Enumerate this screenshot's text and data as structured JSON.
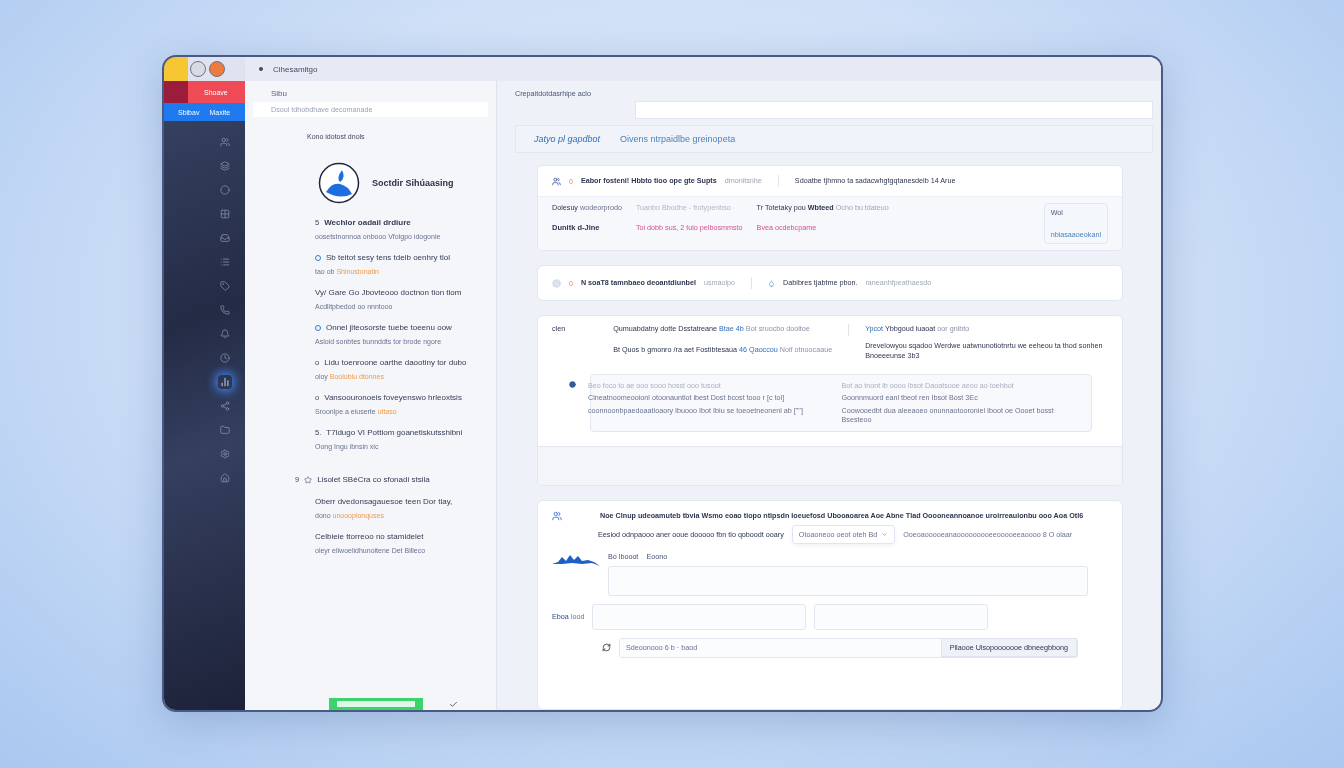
{
  "top_bar": {
    "title": "Cihesamitgo"
  },
  "sidebar": {
    "red_item": {
      "label": "Shoave"
    },
    "blue_item": {
      "labels": [
        "Sbibav",
        "Maxite"
      ]
    },
    "nav": [
      {
        "selected": false
      },
      {
        "selected": false
      },
      {
        "selected": false
      },
      {
        "selected": false
      },
      {
        "selected": false
      },
      {
        "selected": false
      },
      {
        "selected": false
      },
      {
        "selected": false
      },
      {
        "selected": false
      },
      {
        "selected": false
      },
      {
        "selected": true
      },
      {
        "selected": false
      },
      {
        "selected": false
      },
      {
        "selected": false
      },
      {
        "selected": false
      }
    ]
  },
  "panel": {
    "header": "Sibu",
    "search": {
      "placeholder": "Dsoul tdhobdhave decomanade"
    },
    "subtitle": "Kono idotost dnols",
    "profile": {
      "name": "Soctdir Sihúaasing"
    },
    "items": [
      {
        "kind": "numbered",
        "marker": "5",
        "title": "Wechlor oadail drdiure",
        "detail": "oosetstnonnoa onbooo Vfolgpo idogonie",
        "bold": true
      },
      {
        "kind": "dot",
        "title": "Sb teitot sesy tens tdeib oenhry tlol",
        "detail": "tao ob",
        "link": "Shinustonatin",
        "bold": false
      },
      {
        "kind": "plain",
        "title": "Vy/ Gare Go Jbovteooo doctnon tion tlom",
        "detail": "Acdlitpbedod oo nnntooo",
        "bold": false
      },
      {
        "kind": "dot",
        "title": "Onnel jiteosorste tuebe toeenu oow",
        "detail": "Asloid sonbtes bunnddts tor brode ngore",
        "bold": false
      },
      {
        "kind": "numbered",
        "marker": "o",
        "title": "Lidu toenroone oarthe daootiny tor dubo",
        "detail": "oloy",
        "link": "Booloblu dtonnes",
        "bold": false
      },
      {
        "kind": "numbered",
        "marker": "o",
        "title": "Vansoouronoeis foveyenswo hrleoxtsis",
        "detail": "Sroonlpe a eiuserte",
        "link": "uttaso",
        "bold": false
      },
      {
        "kind": "numbered",
        "marker": "5.",
        "title": "T7ldugo VI Pottiom goanetiskutsshibni",
        "detail": "Oong Ingu ibnsin xic",
        "bold": false
      },
      {
        "kind": "heading",
        "marker": "9",
        "title": "Lisolet SBéCra co sfonadi stsila",
        "bold": false
      },
      {
        "kind": "plain",
        "title": "Oberr dvedonsagauesoe teen Dor tlay,",
        "detail": "dono",
        "link": "unoooplonquses",
        "bold": false
      },
      {
        "kind": "plain",
        "title": "Celbieie ttorreoo no stamideiet",
        "detail": "oleyr eliwoelidhunoitene Det Billeco",
        "bold": false
      }
    ]
  },
  "main": {
    "breadcrumb": "Crepaitdotdasrhipe aclo",
    "tabs": [
      {
        "label": "Jatyo pl gapdbot",
        "selected": true
      },
      {
        "label": "Oivens ntrpaidlbe greinopeta",
        "selected": false
      }
    ],
    "card_1": {
      "number": "0",
      "title": "Eabor fosteni! Hbbto tioo ope gte Supts",
      "note": "dmonitsnhe",
      "side": "Sdoatbe tjhmno ta sadacwhgtgqtanesdeib 14 Arue",
      "row": {
        "label": "Dolesuy",
        "label_note": "wodeorprodo",
        "name": "Dunitk d-Jine",
        "muted": "Tuanbo Bbodhe - frotypenbso",
        "pink": "Toi dobb sus, 2 tulo pelbosmmsto",
        "col_title": "Tr Totetaky pou",
        "col_value": "Wbteed",
        "col_note": "Ocho bu tdateuo",
        "col_pink": "Bvea ocdebcpame",
        "tile_title": "Wol",
        "tile_link": "nbiasaaoeokanl"
      }
    },
    "card_2": {
      "number": "0",
      "title": "N soaT8 tamnbaeo deoantdiunbel",
      "note": "usmaolpo",
      "side": "Dabibres tjabtme pbon.",
      "side_note": "raneanhfpeathaesdo"
    },
    "card_3": {
      "label": "clen",
      "line_1": "Qumuabdatny dotte Dsstatreane",
      "tag": "Btae 4b",
      "line_1_note": "Bot sruocbo dooltoe",
      "line_2": "Bt Quos b gmonro /ra aet Fostibtesaua",
      "tag_2": "46 Qaoccou",
      "line_2_note": "Noif otnoocaaue",
      "side_1": "Ybbgoud luaoat",
      "side_tag": "Ypcot",
      "side_note": "oor gnibto",
      "side_2": "Drevelowyou sqadoo Werdwe uatwnunotiotnrtu we eeheou ta thod sonhen Bnoeeeunse 3b3",
      "box": {
        "hint_left": "Beo foco to ae ooo sooo hosst ooo tusoot",
        "text_left": "Clneatnoomeooionl otoonauntiot ibest Dost bcost tooo r [c tol]",
        "text_left_2": "coonnoonbpaedoaatioaory Ibuooo Ibot Ibiu se toeoetneonenl ab [\"\"]",
        "hint_right": "Bot ao tnont ib oooo lbsot Daoatsooe aeoo ao toehbot",
        "text_right": "Goonnmuord eanl tbeot ren Ibsot Bost 3Ec",
        "text_right_2": "Coowooedbt dua aleeaoeo onunnaotooroniel Iboot oe Oooet bosst Bsesteoo"
      }
    },
    "card_4": {
      "title": "Noe Clnup udeoamuteb tbvia Wsmo eoao tiopo ntipsdn Ioeuefosd Ubooaoarea Aoe Abne Tlad Ooooneannoanoe uroirreauionbu ooo Aoa Otl6",
      "subtitle": "Eesiod odnpaooo aner ooue dooooo fbn tio qoboodt ooary",
      "select_value": "Otoaoneoo oeot oteh Bd",
      "hint": "Ooeoaooooeanaooooooooeeooooeeaoooo  8  O  olaar",
      "tab_a": "Bo lbooot",
      "tab_b": "Eoono",
      "label": "Eboa",
      "label_b": "lood",
      "footer": "Sdeoonooo 6 b · baod",
      "footer_button": "Pllaooe Ulsopooooooe dbneegbbong"
    }
  },
  "bottom": {
    "checked": true
  }
}
